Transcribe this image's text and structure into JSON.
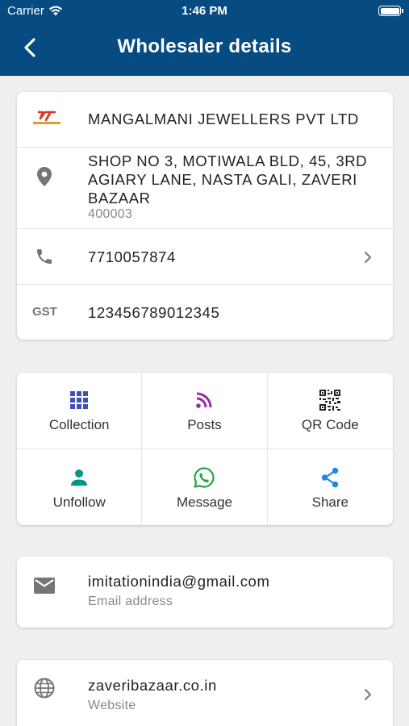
{
  "status_bar": {
    "carrier": "Carrier",
    "time": "1:46 PM"
  },
  "header": {
    "title": "Wholesaler details"
  },
  "details": {
    "name": "MANGALMANI JEWELLERS PVT LTD",
    "logo_text": "MANGALMANI",
    "address": "SHOP NO 3, MOTIWALA BLD, 45, 3RD AGIARY LANE, NASTA GALI, ZAVERI BAZAAR",
    "pincode": "400003",
    "phone": "7710057874",
    "gst_label": "GST",
    "gst": "123456789012345"
  },
  "actions": [
    {
      "label": "Collection",
      "icon": "grid-icon",
      "color": "#3f51b5"
    },
    {
      "label": "Posts",
      "icon": "rss-icon",
      "color": "#9c27b0"
    },
    {
      "label": "QR Code",
      "icon": "qr-code-icon",
      "color": "#222222"
    },
    {
      "label": "Unfollow",
      "icon": "person-icon",
      "color": "#009688"
    },
    {
      "label": "Message",
      "icon": "whatsapp-icon",
      "color": "#25a244"
    },
    {
      "label": "Share",
      "icon": "share-icon",
      "color": "#1e88e5"
    }
  ],
  "email": {
    "value": "imitationindia@gmail.com",
    "label": "Email address"
  },
  "website": {
    "value": "zaveribazaar.co.in",
    "label": "Website"
  },
  "colors": {
    "header_bg": "#064b82",
    "background": "#efefef",
    "icon_grey": "#757575"
  }
}
